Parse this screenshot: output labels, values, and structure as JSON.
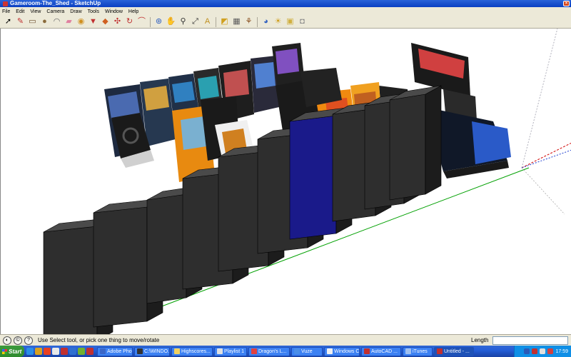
{
  "window": {
    "title": "Gameroom-The_Shed - SketchUp"
  },
  "menu": [
    "File",
    "Edit",
    "View",
    "Camera",
    "Draw",
    "Tools",
    "Window",
    "Help"
  ],
  "toolbar_icons": [
    {
      "name": "select-arrow-icon",
      "glyph": "➚",
      "color": "#000000"
    },
    {
      "name": "line-pencil-icon",
      "glyph": "✎",
      "color": "#c03030"
    },
    {
      "name": "rectangle-icon",
      "glyph": "▭",
      "color": "#6a4a2a"
    },
    {
      "name": "circle-icon",
      "glyph": "●",
      "color": "#8a6a3a"
    },
    {
      "name": "arc-icon",
      "glyph": "◠",
      "color": "#666666"
    },
    {
      "name": "eraser-icon",
      "glyph": "▰",
      "color": "#e080a0"
    },
    {
      "name": "tape-measure-icon",
      "glyph": "◉",
      "color": "#d09020"
    },
    {
      "name": "paint-bucket-icon",
      "glyph": "▼",
      "color": "#c03030"
    },
    {
      "name": "push-pull-icon",
      "glyph": "◆",
      "color": "#d06020"
    },
    {
      "name": "move-icon",
      "glyph": "✣",
      "color": "#c03030"
    },
    {
      "name": "rotate-icon",
      "glyph": "↻",
      "color": "#c03030"
    },
    {
      "name": "follow-me-icon",
      "glyph": "⌒",
      "color": "#c03030"
    },
    {
      "name": "orbit-icon",
      "glyph": "⊛",
      "color": "#3060c0"
    },
    {
      "name": "pan-hand-icon",
      "glyph": "✋",
      "color": "#555555"
    },
    {
      "name": "zoom-icon",
      "glyph": "⚲",
      "color": "#333333"
    },
    {
      "name": "zoom-extents-icon",
      "glyph": "⤢",
      "color": "#333333"
    },
    {
      "name": "text-tag-icon",
      "glyph": "A",
      "color": "#c09020"
    },
    {
      "name": "section-plane-icon",
      "glyph": "◩",
      "color": "#d0a020"
    },
    {
      "name": "components-icon",
      "glyph": "▦",
      "color": "#5a5a5a"
    },
    {
      "name": "walk-icon",
      "glyph": "⚘",
      "color": "#8a5020"
    },
    {
      "name": "look-around-icon",
      "glyph": "◕",
      "color": "#3060c0"
    },
    {
      "name": "shadows-icon",
      "glyph": "☀",
      "color": "#d0a020"
    },
    {
      "name": "fog-icon",
      "glyph": "▣",
      "color": "#d0b040"
    },
    {
      "name": "materials-icon",
      "glyph": "◘",
      "color": "#888888"
    }
  ],
  "status": {
    "message": "Use Select tool, or pick one thing to move/rotate",
    "length_label": "Length",
    "length_value": ""
  },
  "taskbar": {
    "start_label": "Start",
    "quick_launch": [
      "#2a8ee8",
      "#d8a020",
      "#e84020",
      "#e8e8e8",
      "#c03030",
      "#3070d0",
      "#70b030",
      "#c03030"
    ],
    "tasks": [
      {
        "label": "Adobe Pho...",
        "icon": "#3a66c8",
        "active": false
      },
      {
        "label": "C:\\WINDO...",
        "icon": "#333333",
        "active": false
      },
      {
        "label": "Highscores...",
        "icon": "#f0d060",
        "active": false
      },
      {
        "label": "Playlist 1",
        "icon": "#e0e0e0",
        "active": false
      },
      {
        "label": "Dragon's L...",
        "icon": "#e04040",
        "active": false
      },
      {
        "label": "Vuze",
        "icon": "#4a8ee8",
        "active": false
      },
      {
        "label": "Windows C...",
        "icon": "#f0f0f0",
        "active": false
      },
      {
        "label": "AutoCAD ...",
        "icon": "#c03030",
        "active": false
      },
      {
        "label": "iTunes",
        "icon": "#a0c0f0",
        "active": false
      },
      {
        "label": "Untitled - ...",
        "icon": "#c03030",
        "active": true
      }
    ],
    "clock": "17:59",
    "tray_icons": [
      "#2a5ab8",
      "#c03030",
      "#e0e0e0",
      "#d04040"
    ]
  },
  "scene": {
    "background": "#ffffff",
    "cabinet_front_color": "#2e2e2e",
    "cabinet_side_color": "#1c1c1c",
    "cabinet_top_color": "#4a4a4a",
    "blue_cabinet_color": "#1a1a8a",
    "orange_cabinet_color": "#f08a10",
    "axis_green": "#00a000",
    "axis_red": "#d00000",
    "axis_blue": "#2040d0"
  }
}
